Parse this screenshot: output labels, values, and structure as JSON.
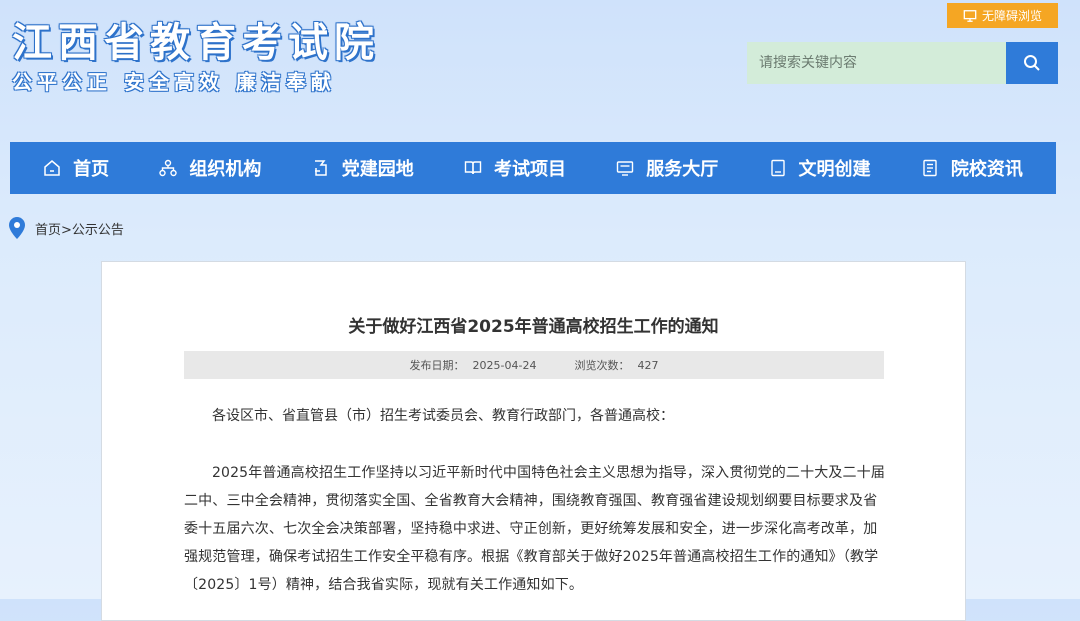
{
  "header": {
    "site_title": "江西省教育考试院",
    "site_slogan": "公平公正  安全高效  廉洁奉献",
    "accessibility_label": "无障碍浏览",
    "search_placeholder": "请搜索关键内容"
  },
  "nav": {
    "items": [
      {
        "label": "首页",
        "icon": "home-icon"
      },
      {
        "label": "组织机构",
        "icon": "org-chart-icon"
      },
      {
        "label": "党建园地",
        "icon": "party-building-icon"
      },
      {
        "label": "考试项目",
        "icon": "book-icon"
      },
      {
        "label": "服务大厅",
        "icon": "service-hall-icon"
      },
      {
        "label": "文明创建",
        "icon": "notebook-icon"
      },
      {
        "label": "院校资讯",
        "icon": "news-icon"
      }
    ]
  },
  "breadcrumb": {
    "home": "首页",
    "separator": ">",
    "current": "公示公告"
  },
  "article": {
    "title": "关于做好江西省2025年普通高校招生工作的通知",
    "publish_label": "发布日期：",
    "publish_date": "2025-04-24",
    "views_label": "浏览次数：",
    "views": "427",
    "paragraphs": [
      "各设区市、省直管县（市）招生考试委员会、教育行政部门，各普通高校：",
      "2025年普通高校招生工作坚持以习近平新时代中国特色社会主义思想为指导，深入贯彻党的二十大及二十届二中、三中全会精神，贯彻落实全国、全省教育大会精神，围绕教育强国、教育强省建设规划纲要目标要求及省委十五届六次、七次全会决策部署，坚持稳中求进、守正创新，更好统筹发展和安全，进一步深化高考改革，加强规范管理，确保考试招生工作安全平稳有序。根据《教育部关于做好2025年普通高校招生工作的通知》（教学〔2025〕1号）精神，结合我省实际，现就有关工作通知如下。"
    ]
  },
  "colors": {
    "nav_blue": "#2f7bd9",
    "access_orange": "#f5a623",
    "search_green": "#d3ecd9"
  }
}
